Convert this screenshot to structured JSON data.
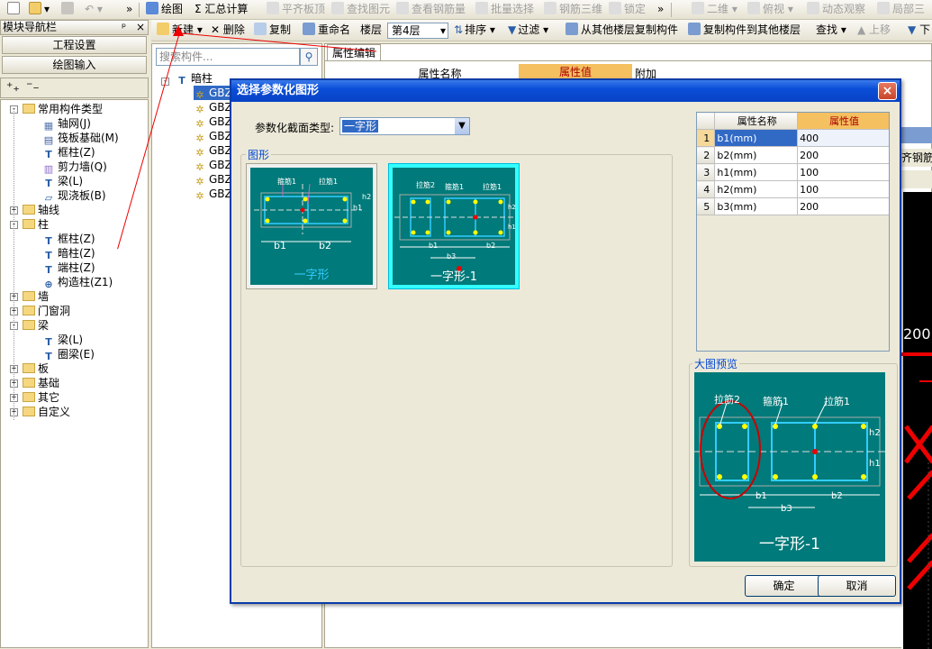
{
  "toolbar1": {
    "items": [
      {
        "label": "绘图",
        "icon": "draw-icon"
      },
      {
        "label": "Σ 汇总计算",
        "icon": "sum-icon"
      },
      {
        "label": "平齐板顶",
        "icon": "flat-icon",
        "disabled": true
      },
      {
        "label": "查找图元",
        "icon": "find-icon",
        "disabled": true
      },
      {
        "label": "查看钢筋量",
        "icon": "view-rebar-icon",
        "disabled": true
      },
      {
        "label": "批量选择",
        "icon": "batch-select-icon",
        "disabled": true
      },
      {
        "label": "钢筋三维",
        "icon": "rebar-3d-icon",
        "disabled": true
      },
      {
        "label": "锁定",
        "icon": "lock-icon",
        "disabled": true
      },
      {
        "label": "二维",
        "icon": "2d-icon",
        "disabled": true
      },
      {
        "label": "俯视",
        "icon": "top-view-icon",
        "disabled": true
      },
      {
        "label": "动态观察",
        "icon": "orbit-icon",
        "disabled": true
      },
      {
        "label": "局部三",
        "icon": "partial-3d-icon",
        "disabled": true
      }
    ]
  },
  "toolbar2": {
    "new_label": "新建",
    "delete_label": "删除",
    "copy_label": "复制",
    "rename_label": "重命名",
    "floor_label": "楼层",
    "floor_value": "第4层",
    "sort_label": "排序",
    "filter_label": "过滤",
    "copy_from_label": "从其他楼层复制构件",
    "copy_to_label": "复制构件到其他楼层",
    "find_label": "查找",
    "up_label": "上移",
    "down_label": "下"
  },
  "nav": {
    "header": "模块导航栏",
    "pin": "ᵖ",
    "close": "×",
    "btn_project": "工程设置",
    "btn_draw": "绘图输入",
    "tree": [
      {
        "label": "常用构件类型",
        "level": 0,
        "expand": "-",
        "icon": "folder"
      },
      {
        "label": "轴网(J)",
        "level": 1,
        "icon": "grid"
      },
      {
        "label": "筏板基础(M)",
        "level": 1,
        "icon": "raft"
      },
      {
        "label": "框柱(Z)",
        "level": 1,
        "icon": "col"
      },
      {
        "label": "剪力墙(Q)",
        "level": 1,
        "icon": "wall"
      },
      {
        "label": "梁(L)",
        "level": 1,
        "icon": "beam"
      },
      {
        "label": "现浇板(B)",
        "level": 1,
        "icon": "slab"
      },
      {
        "label": "轴线",
        "level": 0,
        "expand": "+",
        "icon": "folder"
      },
      {
        "label": "柱",
        "level": 0,
        "expand": "-",
        "icon": "folder"
      },
      {
        "label": "框柱(Z)",
        "level": 1,
        "icon": "col"
      },
      {
        "label": "暗柱(Z)",
        "level": 1,
        "icon": "col"
      },
      {
        "label": "端柱(Z)",
        "level": 1,
        "icon": "col"
      },
      {
        "label": "构造柱(Z1)",
        "level": 1,
        "icon": "col2"
      },
      {
        "label": "墙",
        "level": 0,
        "expand": "+",
        "icon": "folder"
      },
      {
        "label": "门窗洞",
        "level": 0,
        "expand": "+",
        "icon": "folder"
      },
      {
        "label": "梁",
        "level": 0,
        "expand": "-",
        "icon": "folder"
      },
      {
        "label": "梁(L)",
        "level": 1,
        "icon": "beam"
      },
      {
        "label": "圈梁(E)",
        "level": 1,
        "icon": "beam"
      },
      {
        "label": "板",
        "level": 0,
        "expand": "+",
        "icon": "folder"
      },
      {
        "label": "基础",
        "level": 0,
        "expand": "+",
        "icon": "folder"
      },
      {
        "label": "其它",
        "level": 0,
        "expand": "+",
        "icon": "folder"
      },
      {
        "label": "自定义",
        "level": 0,
        "expand": "+",
        "icon": "folder"
      }
    ]
  },
  "component_list": {
    "search_placeholder": "搜索构件...",
    "root": "暗柱",
    "items": [
      "GBZ",
      "GBZ",
      "GBZ",
      "GBZ",
      "GBZ",
      "GBZ",
      "GBZ",
      "GBZ"
    ]
  },
  "props_panel": {
    "tab": "属性编辑",
    "col_name": "属性名称",
    "col_value": "属性值",
    "col_extra": "附加",
    "partial_right_text": "齐钢筋",
    "canvas_number": "200"
  },
  "dialog": {
    "title": "选择参数化图形",
    "section_type_label": "参数化截面类型:",
    "section_type_value": "一字形",
    "shapes_group": "图形",
    "preview_group": "大图预览",
    "shapes": [
      {
        "caption": "一字形",
        "selected": false,
        "labels": [
          "箍筋1",
          "拉筋1",
          "b1",
          "b2",
          "h1",
          "h2"
        ]
      },
      {
        "caption": "一字形-1",
        "selected": true,
        "labels": [
          "拉筋2",
          "箍筋1",
          "拉筋1",
          "b1",
          "b2",
          "b3",
          "h1",
          "h2"
        ]
      }
    ],
    "preview": {
      "caption": "一字形-1",
      "labels": [
        "拉筋2",
        "箍筋1",
        "拉筋1",
        "b1",
        "b2",
        "b3",
        "h1",
        "h2"
      ]
    },
    "grid_header_name": "属性名称",
    "grid_header_value": "属性值",
    "rows": [
      {
        "idx": "1",
        "name": "b1(mm)",
        "value": "400"
      },
      {
        "idx": "2",
        "name": "b2(mm)",
        "value": "200"
      },
      {
        "idx": "3",
        "name": "h1(mm)",
        "value": "100"
      },
      {
        "idx": "4",
        "name": "h2(mm)",
        "value": "100"
      },
      {
        "idx": "5",
        "name": "b3(mm)",
        "value": "200"
      }
    ],
    "ok": "确定",
    "cancel": "取消"
  },
  "colors": {
    "accent": "#0a4ed8",
    "teal": "#007a7a",
    "red": "#e00000",
    "highlight_header": "#f5c060"
  }
}
